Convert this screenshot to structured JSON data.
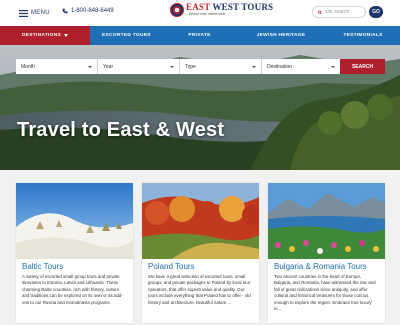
{
  "header": {
    "menu_label": "MENU",
    "phone": "1-800-848-6449",
    "logo_title_part1": "EAST",
    "logo_title_part2": " WEST TOURS",
    "logo_tagline": "...Where east meets west",
    "search_placeholder": "site search",
    "go_label": "GO"
  },
  "nav": {
    "items": [
      {
        "label": "Destinations",
        "active": true
      },
      {
        "label": "Escorted Tours"
      },
      {
        "label": "Private"
      },
      {
        "label": "Jewish Heritage"
      },
      {
        "label": "Testimonials"
      }
    ]
  },
  "hero": {
    "filters": [
      "Month",
      "Year",
      "Type",
      "Destination"
    ],
    "search_label": "SEARCH",
    "title": "Travel to East & West"
  },
  "cards": [
    {
      "title": "Baltic Tours",
      "text": "A variety of escorted small group tours and private itineraries to Estonia, Latvia and Lithuania. These charming Baltic countries, rich with history, culture and traditions,can be explored on its own or as add-ons to our Russia and Scandinavia programs."
    },
    {
      "title": "Poland Tours",
      "text": "We have a great selection of escorted tours, small groups, and private packages to Poland by local tour operators, that offer superb value and quality. Our tours include everything that Poland has to offer - old history and architecture, beautiful nature,..."
    },
    {
      "title": "Bulgaria & Romania Tours",
      "text": "Two ancient countries in the heart of Europe, Bulgaria, and Romania, have witnessed the rise and fall of great civilizations since antiquity, and offer cultural and historical treasures for those curious enough to explore the region. Embrace true luxury in..."
    }
  ],
  "colors": {
    "navy": "#1f3569",
    "nav_blue": "#1f6fb6",
    "accent_red": "#b0202c"
  }
}
